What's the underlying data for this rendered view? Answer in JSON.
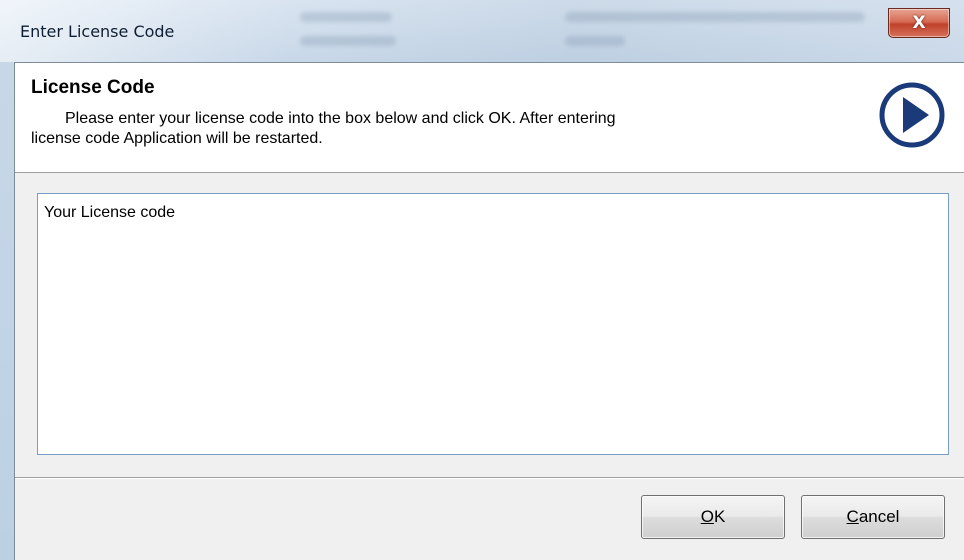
{
  "window": {
    "title": "Enter License Code",
    "close_label": "X"
  },
  "header": {
    "title": "License Code",
    "description_line1": "Please enter your license code into the box below and click OK. After entering",
    "description_line2": "license code Application will be restarted.",
    "icon": "next-arrow-circle-icon",
    "icon_color": "#1a3a7a"
  },
  "license_input": {
    "value": "Your License code"
  },
  "buttons": {
    "ok": {
      "accel": "O",
      "rest": "K"
    },
    "cancel": {
      "accel": "C",
      "rest": "ancel"
    }
  },
  "colors": {
    "icon_blue": "#1a3a7a",
    "input_border": "#7a9cc6",
    "dialog_bg": "#f0f0f0"
  }
}
